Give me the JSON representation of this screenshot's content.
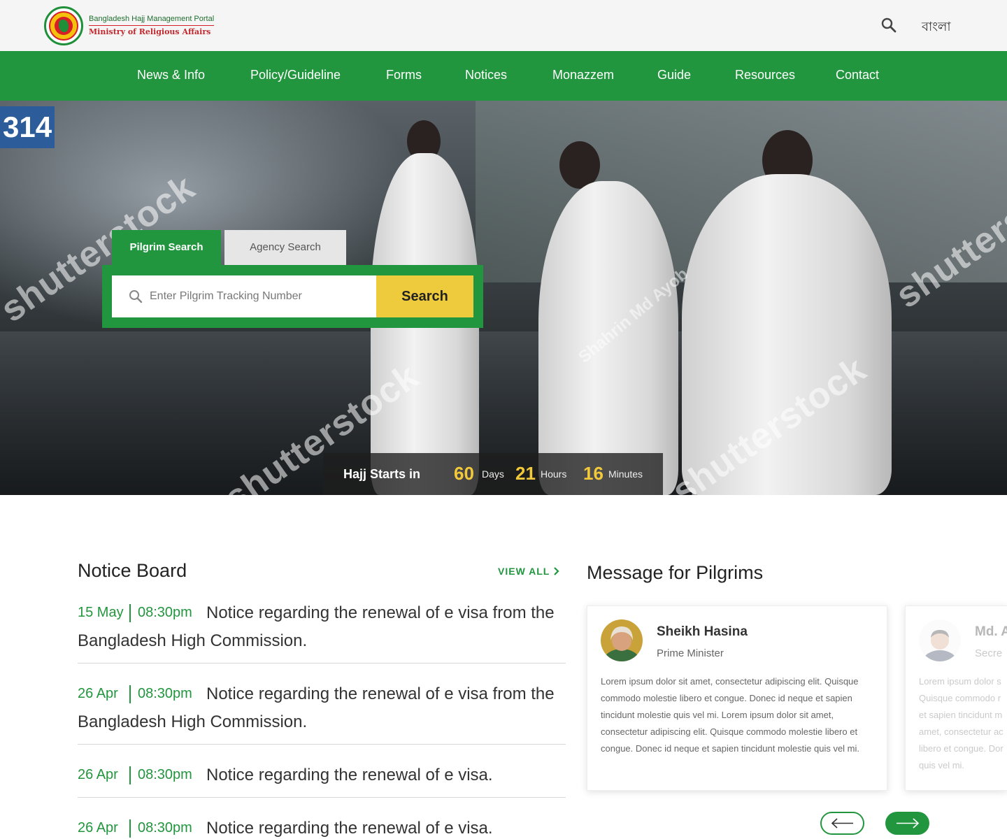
{
  "header": {
    "logo_line1": "Bangladesh Hajj Management Portal",
    "logo_line2": "Ministry of Religious Affairs",
    "search_icon": "search-icon",
    "language_label": "বাংলা"
  },
  "nav": {
    "items": [
      {
        "label": "News & Info"
      },
      {
        "label": "Policy/Guideline"
      },
      {
        "label": "Forms"
      },
      {
        "label": "Notices"
      },
      {
        "label": "Monazzem"
      },
      {
        "label": "Guide"
      },
      {
        "label": "Resources"
      },
      {
        "label": "Contact"
      }
    ]
  },
  "hero": {
    "watermarks": [
      "shutterstock",
      "Shahrin Md Ayob"
    ],
    "sign_text": "314"
  },
  "search": {
    "tabs": [
      {
        "label": "Pilgrim Search",
        "active": true
      },
      {
        "label": "Agency Search",
        "active": false
      }
    ],
    "placeholder": "Enter Pilgrim Tracking Number",
    "value": "",
    "button_label": "Search"
  },
  "countdown": {
    "label": "Hajj Starts in",
    "days": "60",
    "days_unit": "Days",
    "hours": "21",
    "hours_unit": "Hours",
    "minutes": "16",
    "minutes_unit": "Minutes"
  },
  "notice_board": {
    "title": "Notice Board",
    "view_all": "VIEW ALL",
    "items": [
      {
        "date": "15 May",
        "time": "08:30pm",
        "text": "Notice regarding the renewal of e visa from the Bangladesh High Commission."
      },
      {
        "date": "26 Apr",
        "time": "08:30pm",
        "text": "Notice regarding the renewal of e visa from the Bangladesh High Commission."
      },
      {
        "date": "26 Apr",
        "time": "08:30pm",
        "text": "Notice regarding the renewal of e visa."
      },
      {
        "date": "26 Apr",
        "time": "08:30pm",
        "text": "Notice regarding the renewal of e visa."
      }
    ]
  },
  "messages": {
    "title": "Message for Pilgrims",
    "cards": [
      {
        "name": "Sheikh Hasina",
        "role": "Prime Minister",
        "body": "Lorem ipsum dolor sit amet, consectetur adipiscing elit. Quisque commodo molestie libero et congue. Donec id neque et sapien tincidunt molestie quis vel mi. Lorem ipsum dolor sit amet, consectetur adipiscing elit. Quisque commodo molestie libero et congue. Donec id neque et sapien tincidunt molestie quis vel mi."
      },
      {
        "name": "Md. A",
        "role": "Secre",
        "body": "Lorem ipsum dolor s Quisque commodo r et sapien tincidunt m amet, consectetur ac libero et congue. Dor quis vel mi."
      }
    ],
    "prev_icon": "arrow-left-icon",
    "next_icon": "arrow-right-icon"
  },
  "colors": {
    "brand_green": "#22963e",
    "accent_yellow": "#eecb3c",
    "countdown_number": "#f2c93b"
  }
}
